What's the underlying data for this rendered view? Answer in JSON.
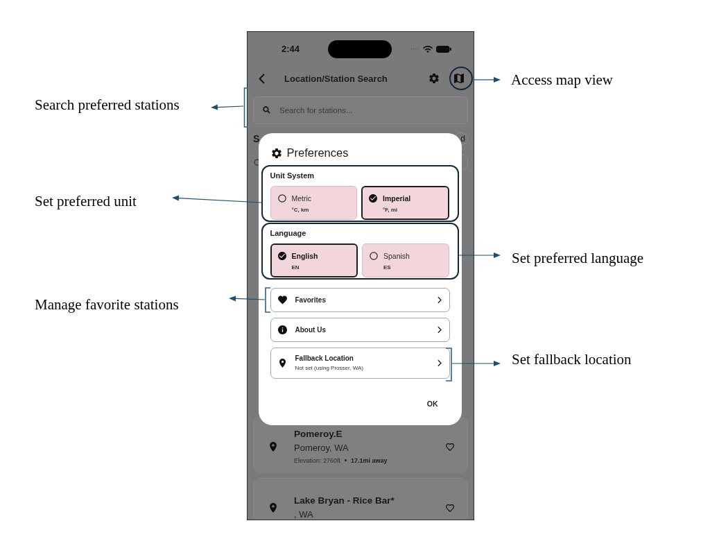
{
  "annotations": [
    {
      "text": "Access map view"
    },
    {
      "text": "Search preferred stations"
    },
    {
      "text": "Set preferred unit"
    },
    {
      "text": "Set preferred language"
    },
    {
      "text": "Manage favorite stations"
    },
    {
      "text": "Set fallback location"
    }
  ],
  "status_bar": {
    "time": "2:44"
  },
  "header": {
    "title": "Location/Station Search"
  },
  "search": {
    "placeholder": "Search for stations..."
  },
  "background_rows": {
    "heading": "S",
    "chip": "d"
  },
  "dialog": {
    "title": "Preferences",
    "sections": [
      {
        "label": "Unit System",
        "options": [
          {
            "label": "Metric",
            "detail": "°C, km",
            "selected": false
          },
          {
            "label": "Imperial",
            "detail": "°F, mi",
            "selected": true
          }
        ]
      },
      {
        "label": "Language",
        "options": [
          {
            "label": "English",
            "detail": "EN",
            "selected": true
          },
          {
            "label": "Spanish",
            "detail": "ES",
            "selected": false
          }
        ]
      }
    ],
    "items": [
      {
        "kind": "heart",
        "label": "Favorites"
      },
      {
        "kind": "info",
        "label": "About Us"
      },
      {
        "kind": "pin",
        "label": "Fallback Location",
        "subtitle": "Not set (using Prosser, WA)"
      }
    ],
    "ok": "OK"
  },
  "stations": [
    {
      "name": "Pomeroy.E",
      "place": "Pomeroy, WA",
      "elevation": "Elevation: 2760ft",
      "distance": "17.1mi away",
      "favorite": false
    },
    {
      "name": "Lake Bryan - Rice Bar*",
      "place": ", WA",
      "favorite": false
    }
  ]
}
